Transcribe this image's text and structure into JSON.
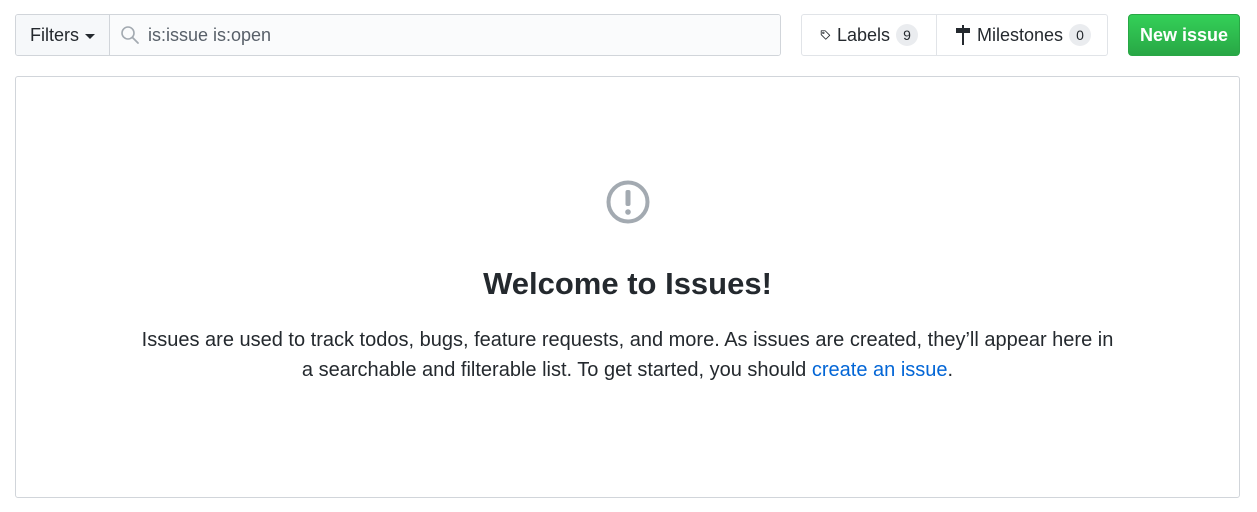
{
  "toolbar": {
    "filters_label": "Filters",
    "search_value": "is:issue is:open",
    "labels_label": "Labels",
    "labels_count": "9",
    "milestones_label": "Milestones",
    "milestones_count": "0",
    "new_issue_label": "New issue"
  },
  "blankslate": {
    "icon": "issue-opened-icon",
    "title": "Welcome to Issues!",
    "text_before": "Issues are used to track todos, bugs, feature requests, and more. As issues are created, they’ll appear here in a searchable and filterable list. To get started, you should ",
    "link_text": "create an issue",
    "text_after": "."
  },
  "colors": {
    "primary_button": "#2cbe4e",
    "link": "#0366d6",
    "icon_gray": "#a3aab1",
    "border": "#d1d5da"
  }
}
